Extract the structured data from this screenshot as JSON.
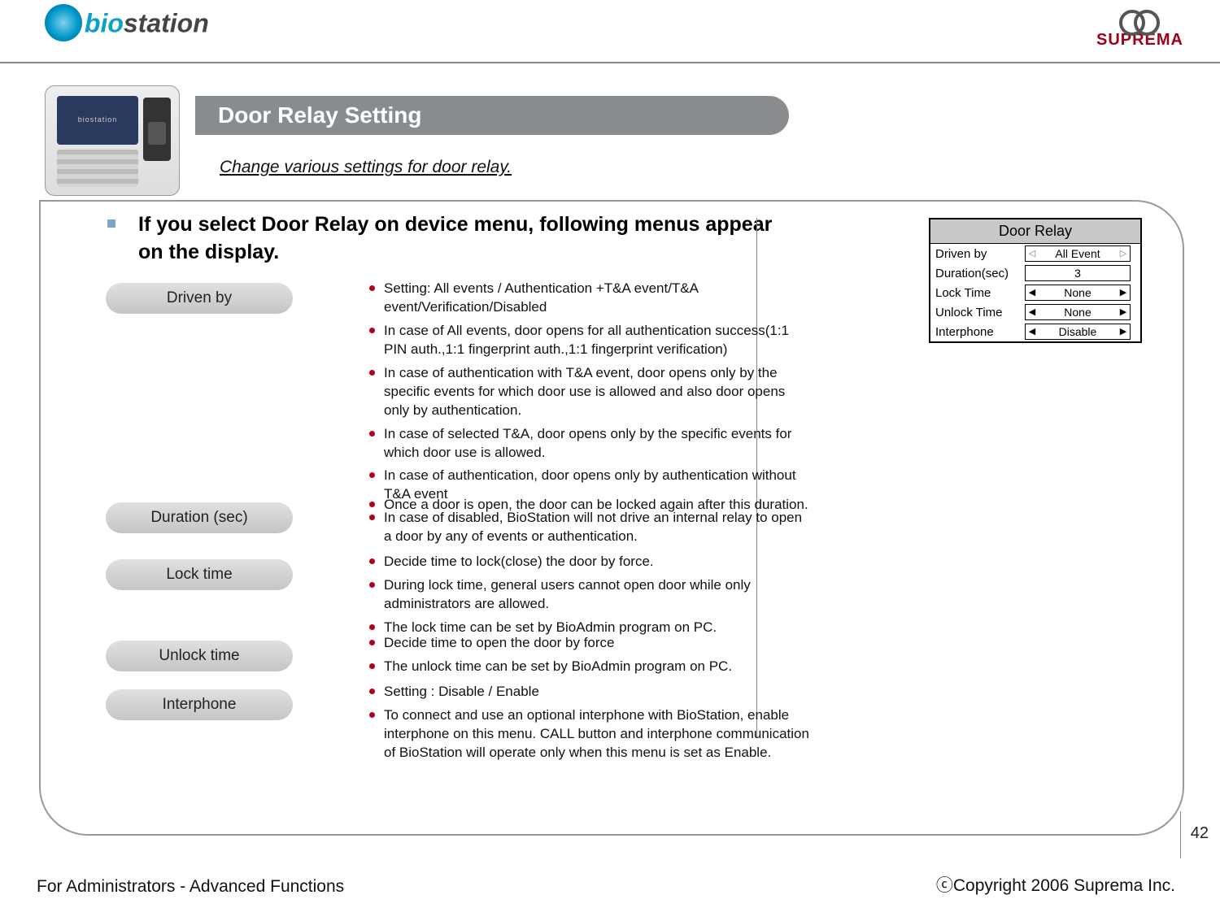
{
  "brand_left": "biostation",
  "brand_right": "SUPREMA",
  "title": "Door Relay Setting",
  "subtitle": "Change various settings for door relay.",
  "lead": "If you select Door Relay on device menu, following menus appear on the display.",
  "rows": {
    "driven_by": {
      "label": "Driven by",
      "bullets": [
        "Setting: All events / Authentication +T&A event/T&A event/Verification/Disabled",
        "In case of All events, door opens for all authentication success(1:1 PIN auth.,1:1 fingerprint auth.,1:1 fingerprint verification)",
        "In case of authentication with T&A event, door opens only by the specific events for which door use is allowed and also door opens only by authentication.",
        "In case of selected T&A, door opens only by the specific events for which door use is allowed.",
        "In case of authentication, door opens only by authentication without T&A event",
        "In case of disabled, BioStation will not drive an internal relay to open a door by any of events or authentication."
      ]
    },
    "duration": {
      "label": "Duration (sec)",
      "bullets": [
        "Once a door is open, the door can be locked again after this duration."
      ]
    },
    "lock_time": {
      "label": "Lock time",
      "bullets": [
        "Decide time to lock(close) the door by force.",
        "During lock time, general users cannot open door while only administrators are allowed.",
        "The lock time can be set by BioAdmin program on PC."
      ]
    },
    "unlock_time": {
      "label": "Unlock time",
      "bullets": [
        "Decide time to open the door by force",
        "The unlock time can be set by BioAdmin program on PC."
      ]
    },
    "interphone": {
      "label": "Interphone",
      "bullets": [
        "Setting : Disable / Enable",
        "To connect and use an optional interphone with BioStation, enable interphone on this menu. CALL button and interphone communication of BioStation will operate only when this menu is set as Enable."
      ]
    }
  },
  "lcd": {
    "title": "Door Relay",
    "items": [
      {
        "label": "Driven by",
        "value": "All Event",
        "arrows": "hollow"
      },
      {
        "label": "Duration(sec)",
        "value": "3",
        "arrows": "none"
      },
      {
        "label": "Lock Time",
        "value": "None",
        "arrows": "solid"
      },
      {
        "label": "Unlock Time",
        "value": "None",
        "arrows": "solid"
      },
      {
        "label": "Interphone",
        "value": "Disable",
        "arrows": "solid"
      }
    ]
  },
  "footer_left": "For Administrators - Advanced Functions",
  "footer_right": "ⓒCopyright 2006 Suprema Inc.",
  "page_number": "42"
}
